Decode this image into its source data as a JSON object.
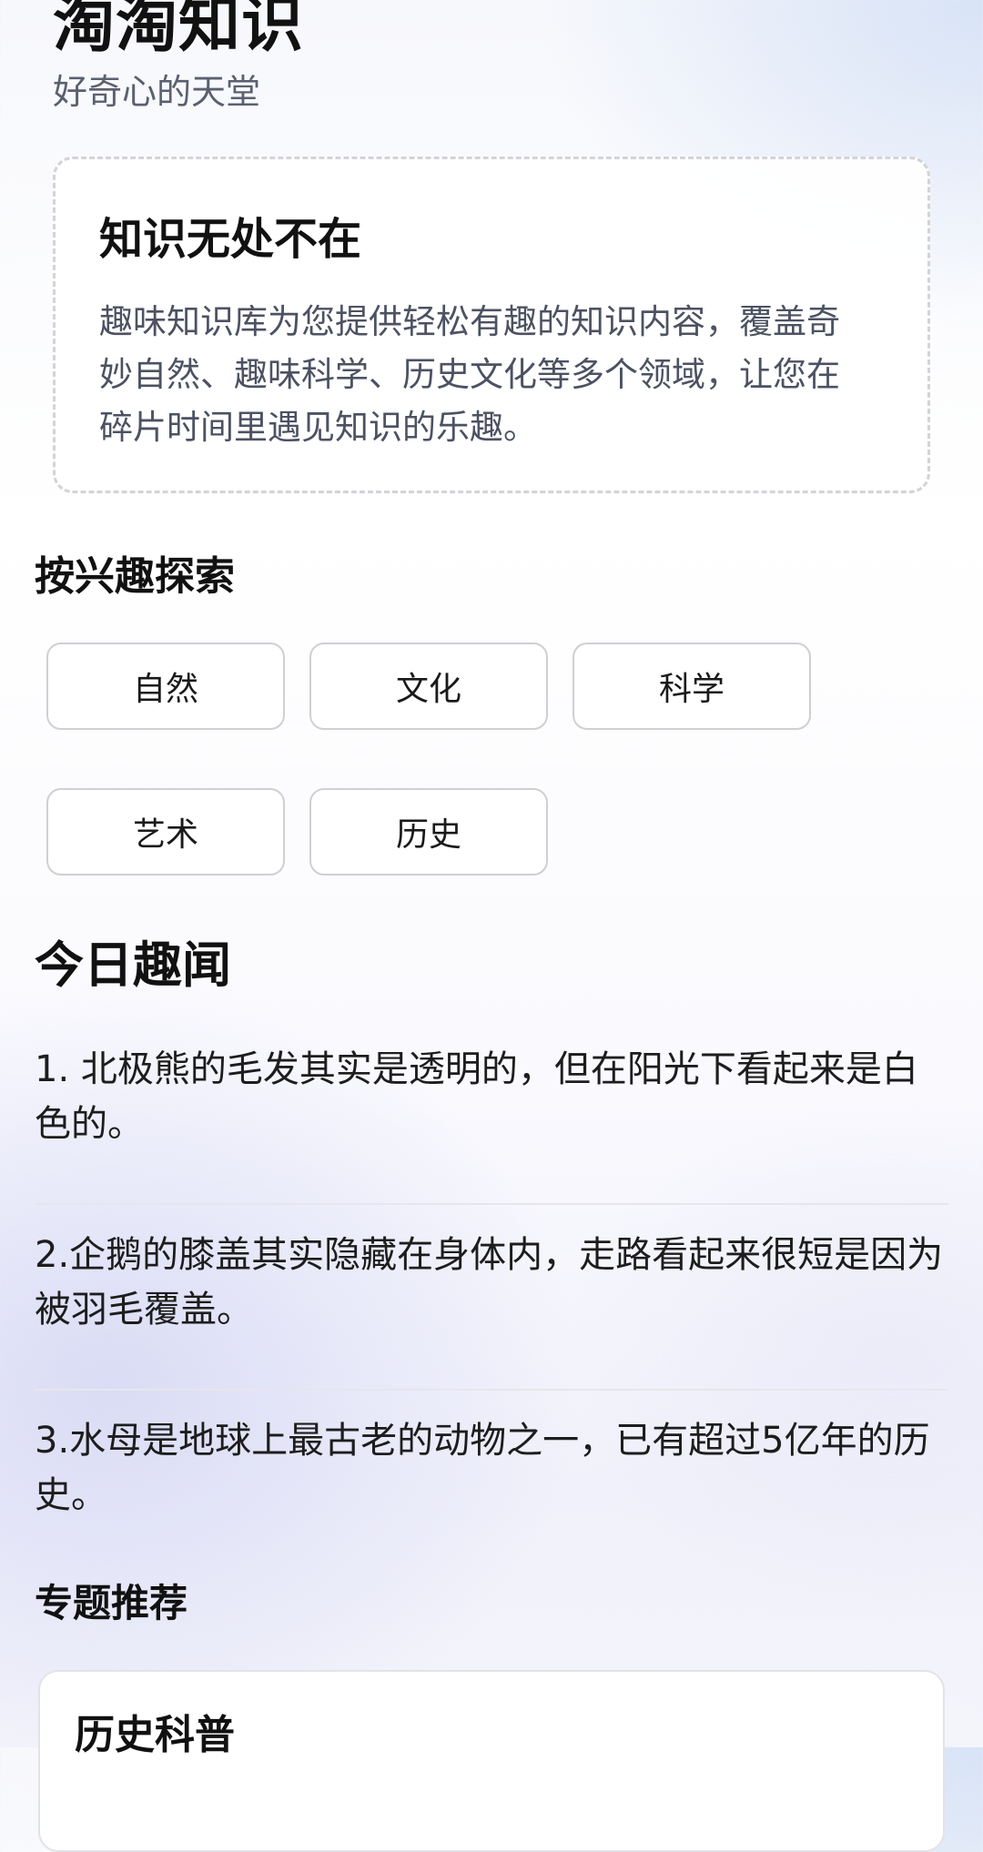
{
  "header": {
    "title": "淘淘知识",
    "subtitle": "好奇心的天堂"
  },
  "intro": {
    "title": "知识无处不在",
    "text": "趣味知识库为您提供轻松有趣的知识内容，覆盖奇妙自然、趣味科学、历史文化等多个领域，让您在碎片时间里遇见知识的乐趣。"
  },
  "interests": {
    "title": "按兴趣探索",
    "tags": [
      "自然",
      "文化",
      "科学",
      "艺术",
      "历史"
    ]
  },
  "today": {
    "title": "今日趣闻",
    "facts": [
      "1. 北极熊的毛发其实是透明的，但在阳光下看起来是白色的。",
      "2.企鹅的膝盖其实隐藏在身体内，走路看起来很短是因为被羽毛覆盖。",
      "3.水母是地球上最古老的动物之一，已有超过5亿年的历史。"
    ]
  },
  "topics": {
    "title": "专题推荐",
    "items": [
      "历史科普"
    ]
  }
}
